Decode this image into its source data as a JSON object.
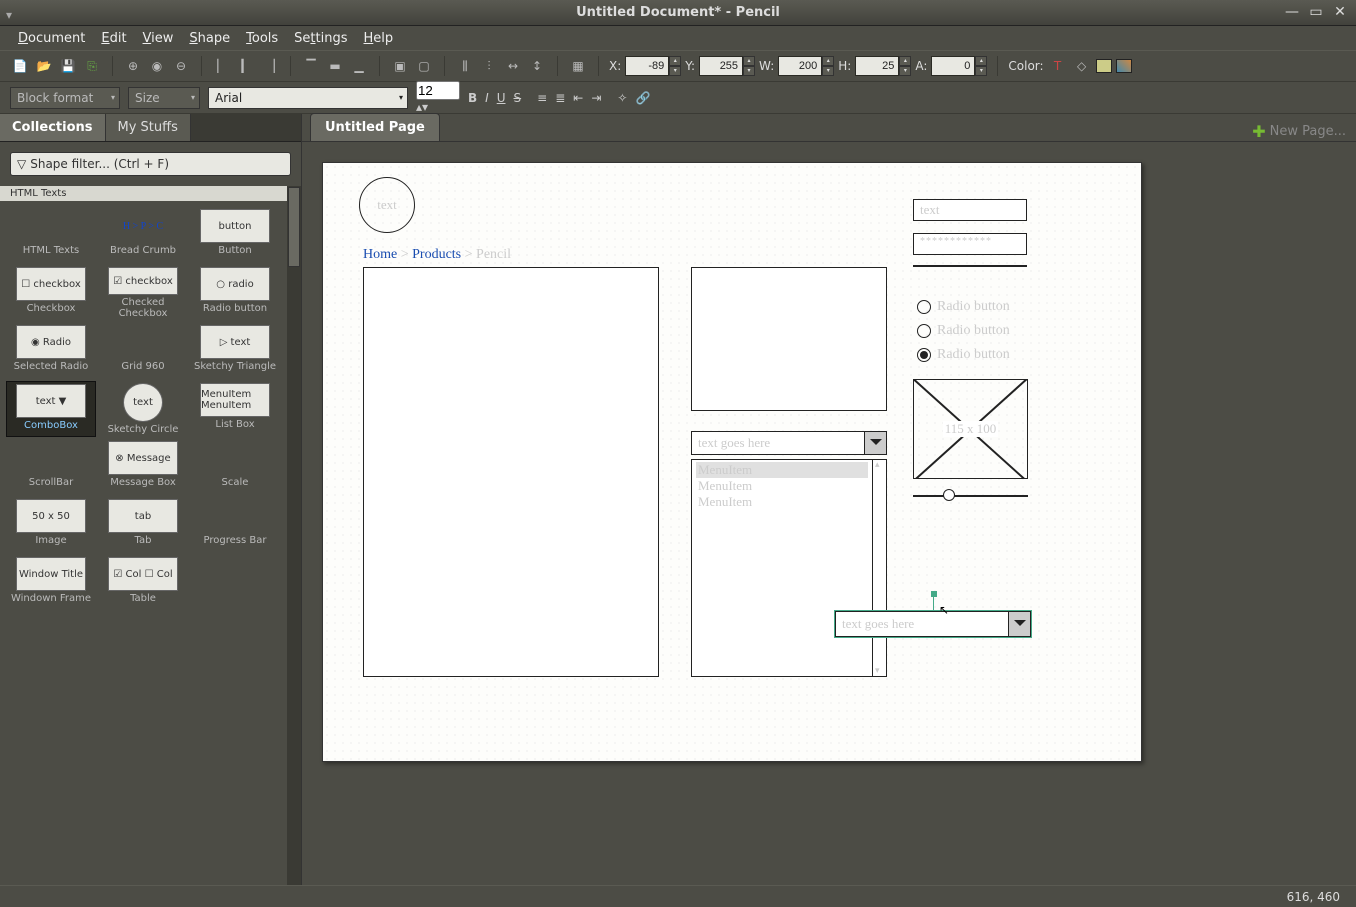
{
  "window": {
    "title": "Untitled Document* - Pencil"
  },
  "menu": {
    "document": "Document",
    "edit": "Edit",
    "view": "View",
    "shape": "Shape",
    "tools": "Tools",
    "settings": "Settings",
    "help": "Help"
  },
  "toolbar": {
    "x_label": "X:",
    "x_value": "-89",
    "y_label": "Y:",
    "y_value": "255",
    "w_label": "W:",
    "w_value": "200",
    "h_label": "H:",
    "h_value": "25",
    "a_label": "A:",
    "a_value": "0",
    "color_label": "Color:"
  },
  "toolbar2": {
    "block_format": "Block format",
    "size_label": "Size",
    "font": "Arial",
    "font_size": "12"
  },
  "sidebar": {
    "tabs": {
      "collections": "Collections",
      "mystuffs": "My Stuffs"
    },
    "filter_placeholder": "Shape filter... (Ctrl + F)",
    "group": "HTML Texts",
    "shapes": [
      {
        "label": "HTML Texts",
        "preview": ""
      },
      {
        "label": "Bread Crumb",
        "preview": "H > P > C"
      },
      {
        "label": "Button",
        "preview": "button"
      },
      {
        "label": "Checkbox",
        "preview": "☐ checkbox"
      },
      {
        "label": "Checked Checkbox",
        "preview": "☑ checkbox"
      },
      {
        "label": "Radio button",
        "preview": "○ radio"
      },
      {
        "label": "Selected Radio",
        "preview": "◉ Radio"
      },
      {
        "label": "Grid 960",
        "preview": ""
      },
      {
        "label": "Sketchy Triangle",
        "preview": "▷ text"
      },
      {
        "label": "ComboBox",
        "preview": "text ▼"
      },
      {
        "label": "Sketchy Circle",
        "preview": "text"
      },
      {
        "label": "List Box",
        "preview": "MenuItem\nMenuItem"
      },
      {
        "label": "ScrollBar",
        "preview": ""
      },
      {
        "label": "Message Box",
        "preview": "⊗ Message"
      },
      {
        "label": "Scale",
        "preview": ""
      },
      {
        "label": "Image",
        "preview": "50 x 50"
      },
      {
        "label": "Tab",
        "preview": "tab"
      },
      {
        "label": "Progress Bar",
        "preview": ""
      },
      {
        "label": "Windown Frame",
        "preview": "Window Title"
      },
      {
        "label": "Table",
        "preview": "☑ Col\n☐ Col"
      }
    ]
  },
  "pagetab": {
    "label": "Untitled Page",
    "new": "New Page..."
  },
  "canvas": {
    "circle_text": "text",
    "breadcrumb": {
      "home": "Home",
      "products": "Products",
      "pencil": "Pencil",
      "sep": " > "
    },
    "input_text": "text",
    "password": "************",
    "radio1": "Radio button",
    "radio2": "Radio button",
    "radio3": "Radio button",
    "image_label": "115 x 100",
    "combo1": "text goes here",
    "combo2": "text goes here",
    "list_items": [
      "MenuItem",
      "MenuItem",
      "MenuItem"
    ]
  },
  "statusbar": {
    "coords": "616, 460"
  }
}
